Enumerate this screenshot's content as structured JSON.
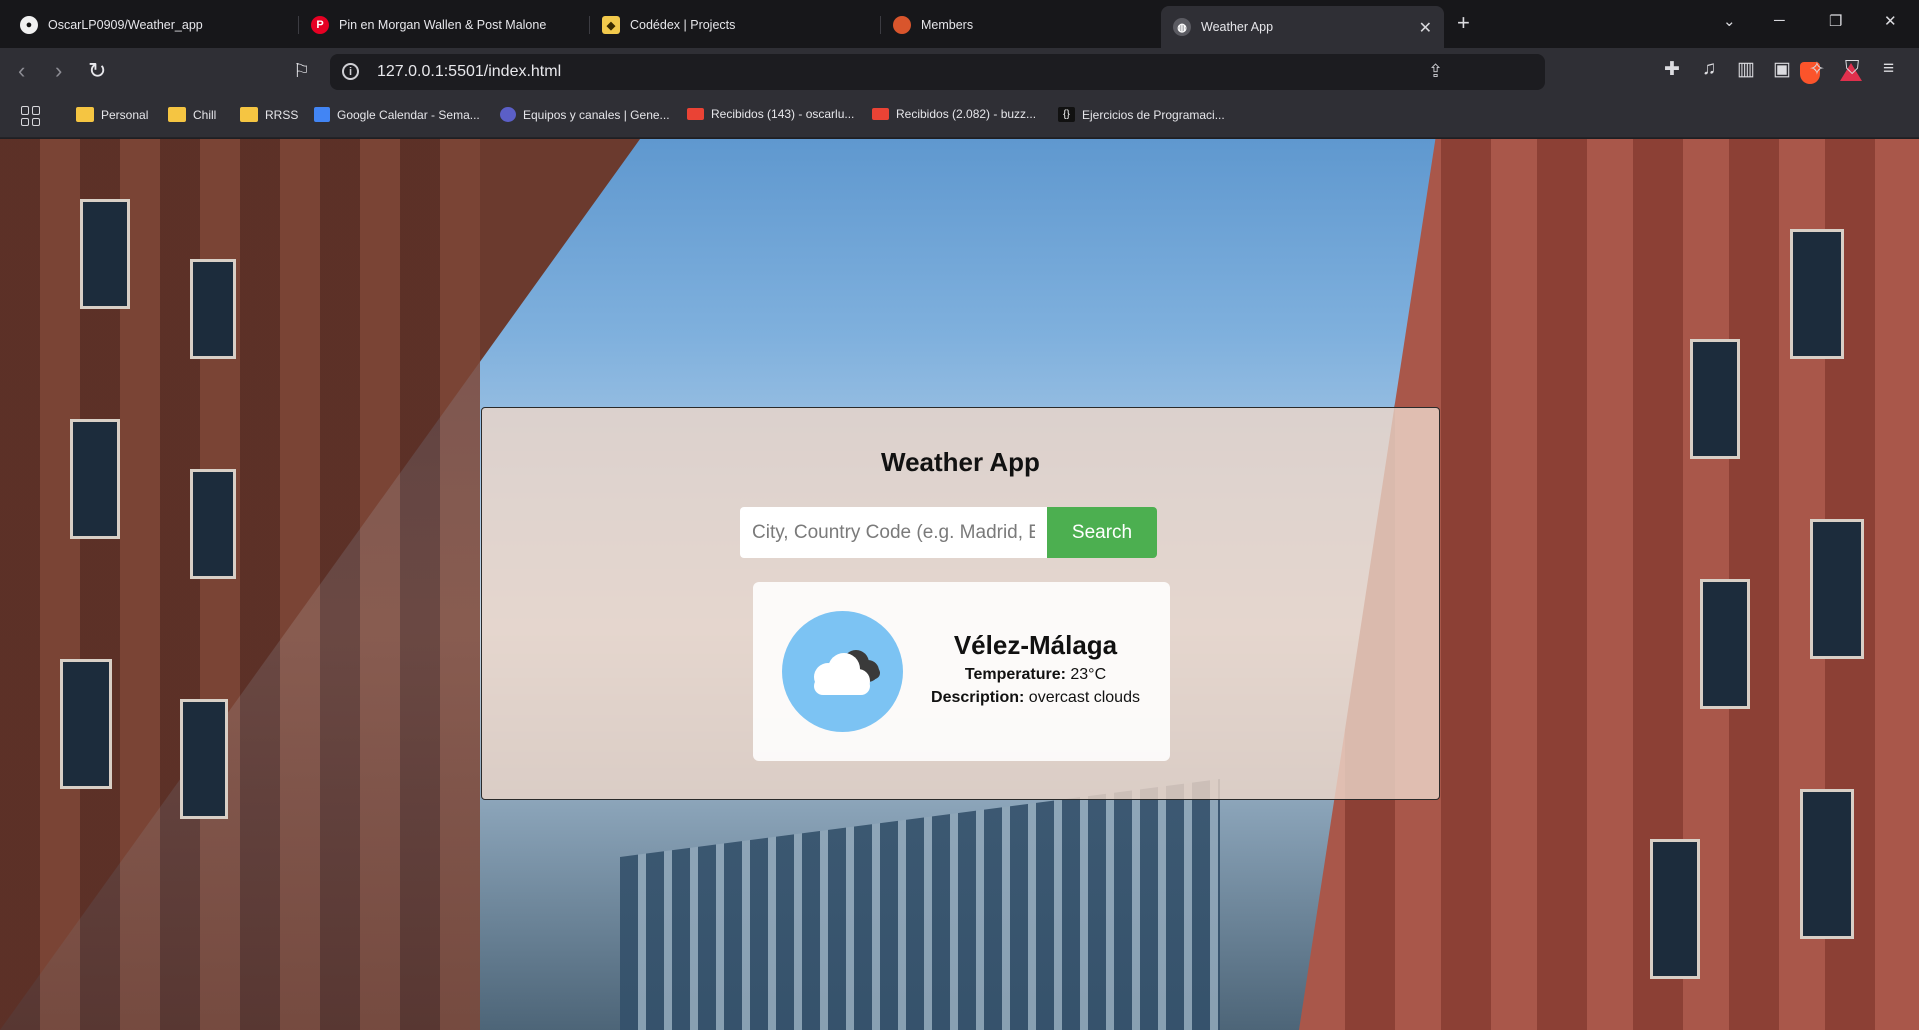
{
  "browser": {
    "tabs": [
      {
        "title": "OscarLP0909/Weather_app",
        "icon": "github-icon"
      },
      {
        "title": "Pin en Morgan Wallen & Post Malone",
        "icon": "pinterest-icon"
      },
      {
        "title": "Codédex | Projects",
        "icon": "codedex-icon"
      },
      {
        "title": "Members",
        "icon": "members-icon"
      },
      {
        "title": "Weather App",
        "icon": "globe-icon",
        "active": true
      }
    ],
    "new_tab": "+",
    "url": "127.0.0.1:5501/index.html",
    "bookmarks": [
      {
        "label": "Personal",
        "icon": "folder-icon"
      },
      {
        "label": "Chill",
        "icon": "folder-icon"
      },
      {
        "label": "RRSS",
        "icon": "folder-icon"
      },
      {
        "label": "Google Calendar - Sema...",
        "icon": "google-calendar-icon"
      },
      {
        "label": "Equipos y canales | Gene...",
        "icon": "teams-icon"
      },
      {
        "label": "Recibidos (143) - oscarlu...",
        "icon": "gmail-icon"
      },
      {
        "label": "Recibidos (2.082) - buzz...",
        "icon": "gmail-icon"
      },
      {
        "label": "Ejercicios de Programaci...",
        "icon": "code-braces-icon"
      }
    ],
    "colors": {
      "brave": "#fb542b",
      "gmail": "#ea4335",
      "calendar": "#4285f4"
    }
  },
  "app": {
    "title": "Weather App",
    "search": {
      "placeholder": "City, Country Code (e.g. Madrid, ES)",
      "value": "",
      "button": "Search"
    },
    "result": {
      "city": "Vélez-Málaga",
      "temperature_label": "Temperature:",
      "temperature_value": " 23°C",
      "description_label": "Description:",
      "description_value": " overcast clouds",
      "icon": "overcast-clouds-icon"
    },
    "colors": {
      "search_button": "#4caf50",
      "icon_bg": "#7cc3f3"
    }
  }
}
